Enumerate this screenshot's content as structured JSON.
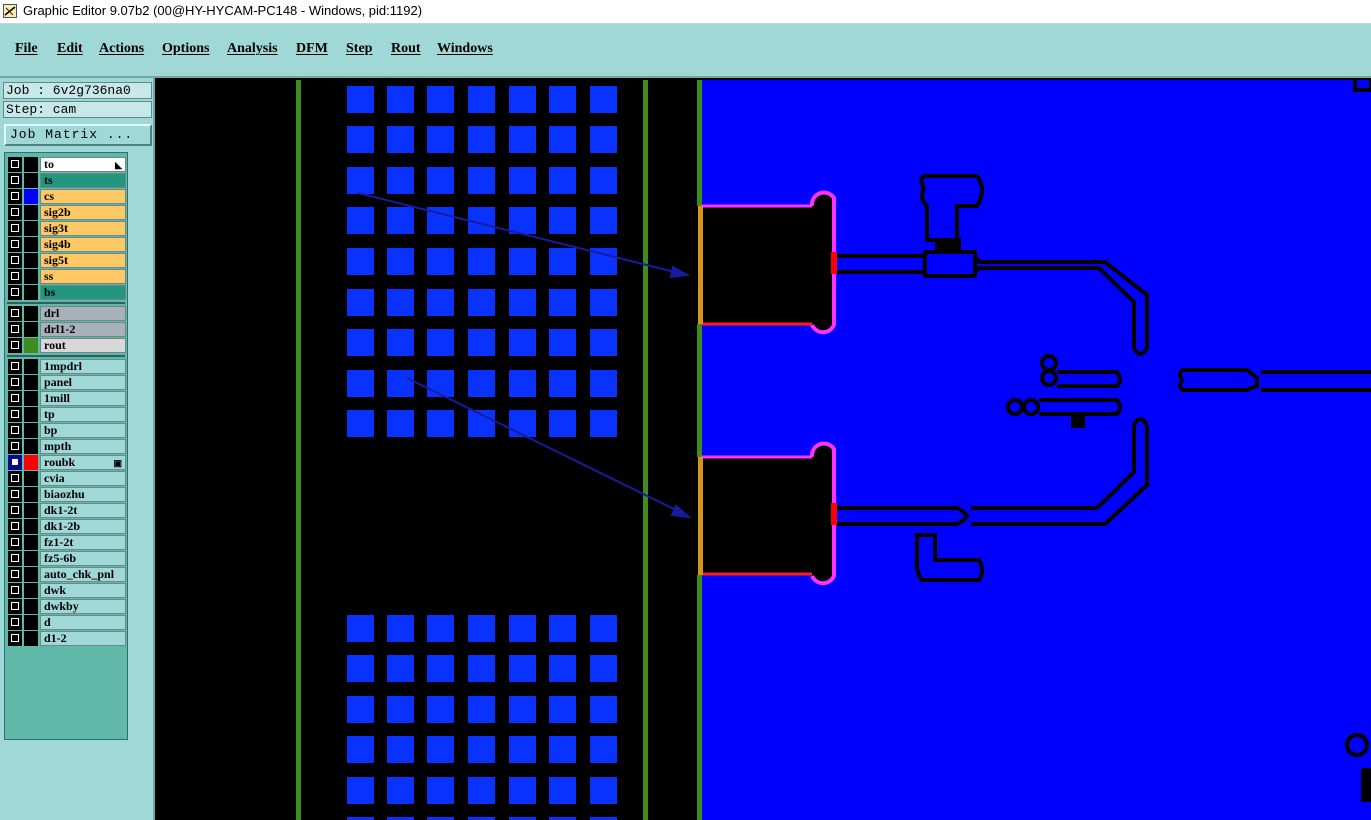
{
  "window": {
    "title": "Graphic Editor 9.07b2 (00@HY-HYCAM-PC148 - Windows, pid:1192)"
  },
  "menu": [
    "File",
    "Edit",
    "Actions",
    "Options",
    "Analysis",
    "DFM",
    "Step",
    "Rout",
    "Windows"
  ],
  "info": {
    "job_text": "Job : 6v2g736na0",
    "step_text": "Step: cam",
    "job_matrix_label": "Job Matrix ..."
  },
  "layers": [
    {
      "name": "to",
      "bg": "#ffffff",
      "swatch": "#000000",
      "checked": false,
      "icon": "cursor-icon"
    },
    {
      "name": "ts",
      "bg": "#24967e",
      "swatch": "#000000",
      "checked": false
    },
    {
      "name": "cs",
      "bg": "#ffc864",
      "swatch": "#0000ff",
      "checked": false
    },
    {
      "name": "sig2b",
      "bg": "#ffc864",
      "swatch": "#000000",
      "checked": false
    },
    {
      "name": "sig3t",
      "bg": "#ffc864",
      "swatch": "#000000",
      "checked": false
    },
    {
      "name": "sig4b",
      "bg": "#ffc864",
      "swatch": "#000000",
      "checked": false
    },
    {
      "name": "sig5t",
      "bg": "#ffc864",
      "swatch": "#000000",
      "checked": false
    },
    {
      "name": "ss",
      "bg": "#ffc864",
      "swatch": "#000000",
      "checked": false
    },
    {
      "name": "bs",
      "bg": "#24967e",
      "swatch": "#000000",
      "checked": false
    },
    {
      "name": "drl",
      "bg": "#a8b0b8",
      "swatch": "#000000",
      "checked": false
    },
    {
      "name": "drl1-2",
      "bg": "#a8b0b8",
      "swatch": "#000000",
      "checked": false
    },
    {
      "name": "rout",
      "bg": "#d8d8d8",
      "swatch": "#3c8c1e",
      "checked": false
    },
    {
      "name": "1mpdrl",
      "bg": "#a0d8d8",
      "swatch": "#000000",
      "checked": false
    },
    {
      "name": "panel",
      "bg": "#a0d8d8",
      "swatch": "#000000",
      "checked": false
    },
    {
      "name": "1mill",
      "bg": "#a0d8d8",
      "swatch": "#000000",
      "checked": false
    },
    {
      "name": "tp",
      "bg": "#a0d8d8",
      "swatch": "#000000",
      "checked": false
    },
    {
      "name": "bp",
      "bg": "#a0d8d8",
      "swatch": "#000000",
      "checked": false
    },
    {
      "name": "mpth",
      "bg": "#a0d8d8",
      "swatch": "#000000",
      "checked": false
    },
    {
      "name": "roubk",
      "bg": "#a0d8d8",
      "swatch": "#ff0000",
      "checked": true,
      "icon": "layer-marker-icon"
    },
    {
      "name": "cvia",
      "bg": "#a0d8d8",
      "swatch": "#000000",
      "checked": false
    },
    {
      "name": "biaozhu",
      "bg": "#a0d8d8",
      "swatch": "#000000",
      "checked": false
    },
    {
      "name": "dk1-2t",
      "bg": "#a0d8d8",
      "swatch": "#000000",
      "checked": false
    },
    {
      "name": "dk1-2b",
      "bg": "#a0d8d8",
      "swatch": "#000000",
      "checked": false
    },
    {
      "name": "fz1-2t",
      "bg": "#a0d8d8",
      "swatch": "#000000",
      "checked": false
    },
    {
      "name": "fz5-6b",
      "bg": "#a0d8d8",
      "swatch": "#000000",
      "checked": false
    },
    {
      "name": "auto_chk_pnl",
      "bg": "#a0d8d8",
      "swatch": "#000000",
      "checked": false
    },
    {
      "name": "dwk",
      "bg": "#a0d8d8",
      "swatch": "#000000",
      "checked": false
    },
    {
      "name": "dwkby",
      "bg": "#a0d8d8",
      "swatch": "#000000",
      "checked": false
    },
    {
      "name": "d",
      "bg": "#a0d8d8",
      "swatch": "#000000",
      "checked": false
    },
    {
      "name": "d1-2",
      "bg": "#a0d8d8",
      "swatch": "#000000",
      "checked": false
    }
  ],
  "colors": {
    "menu_bg": "#a0d8d8",
    "canvas_bg": "#000000",
    "copper": "#0000ff",
    "pad_blue": "#0a32ff",
    "rout_green": "#3c8c1e",
    "outline_magenta": "#ff32ff",
    "outline_red": "#ff0000",
    "outline_orange": "#d2961e",
    "arrow": "#1a1aa0"
  }
}
